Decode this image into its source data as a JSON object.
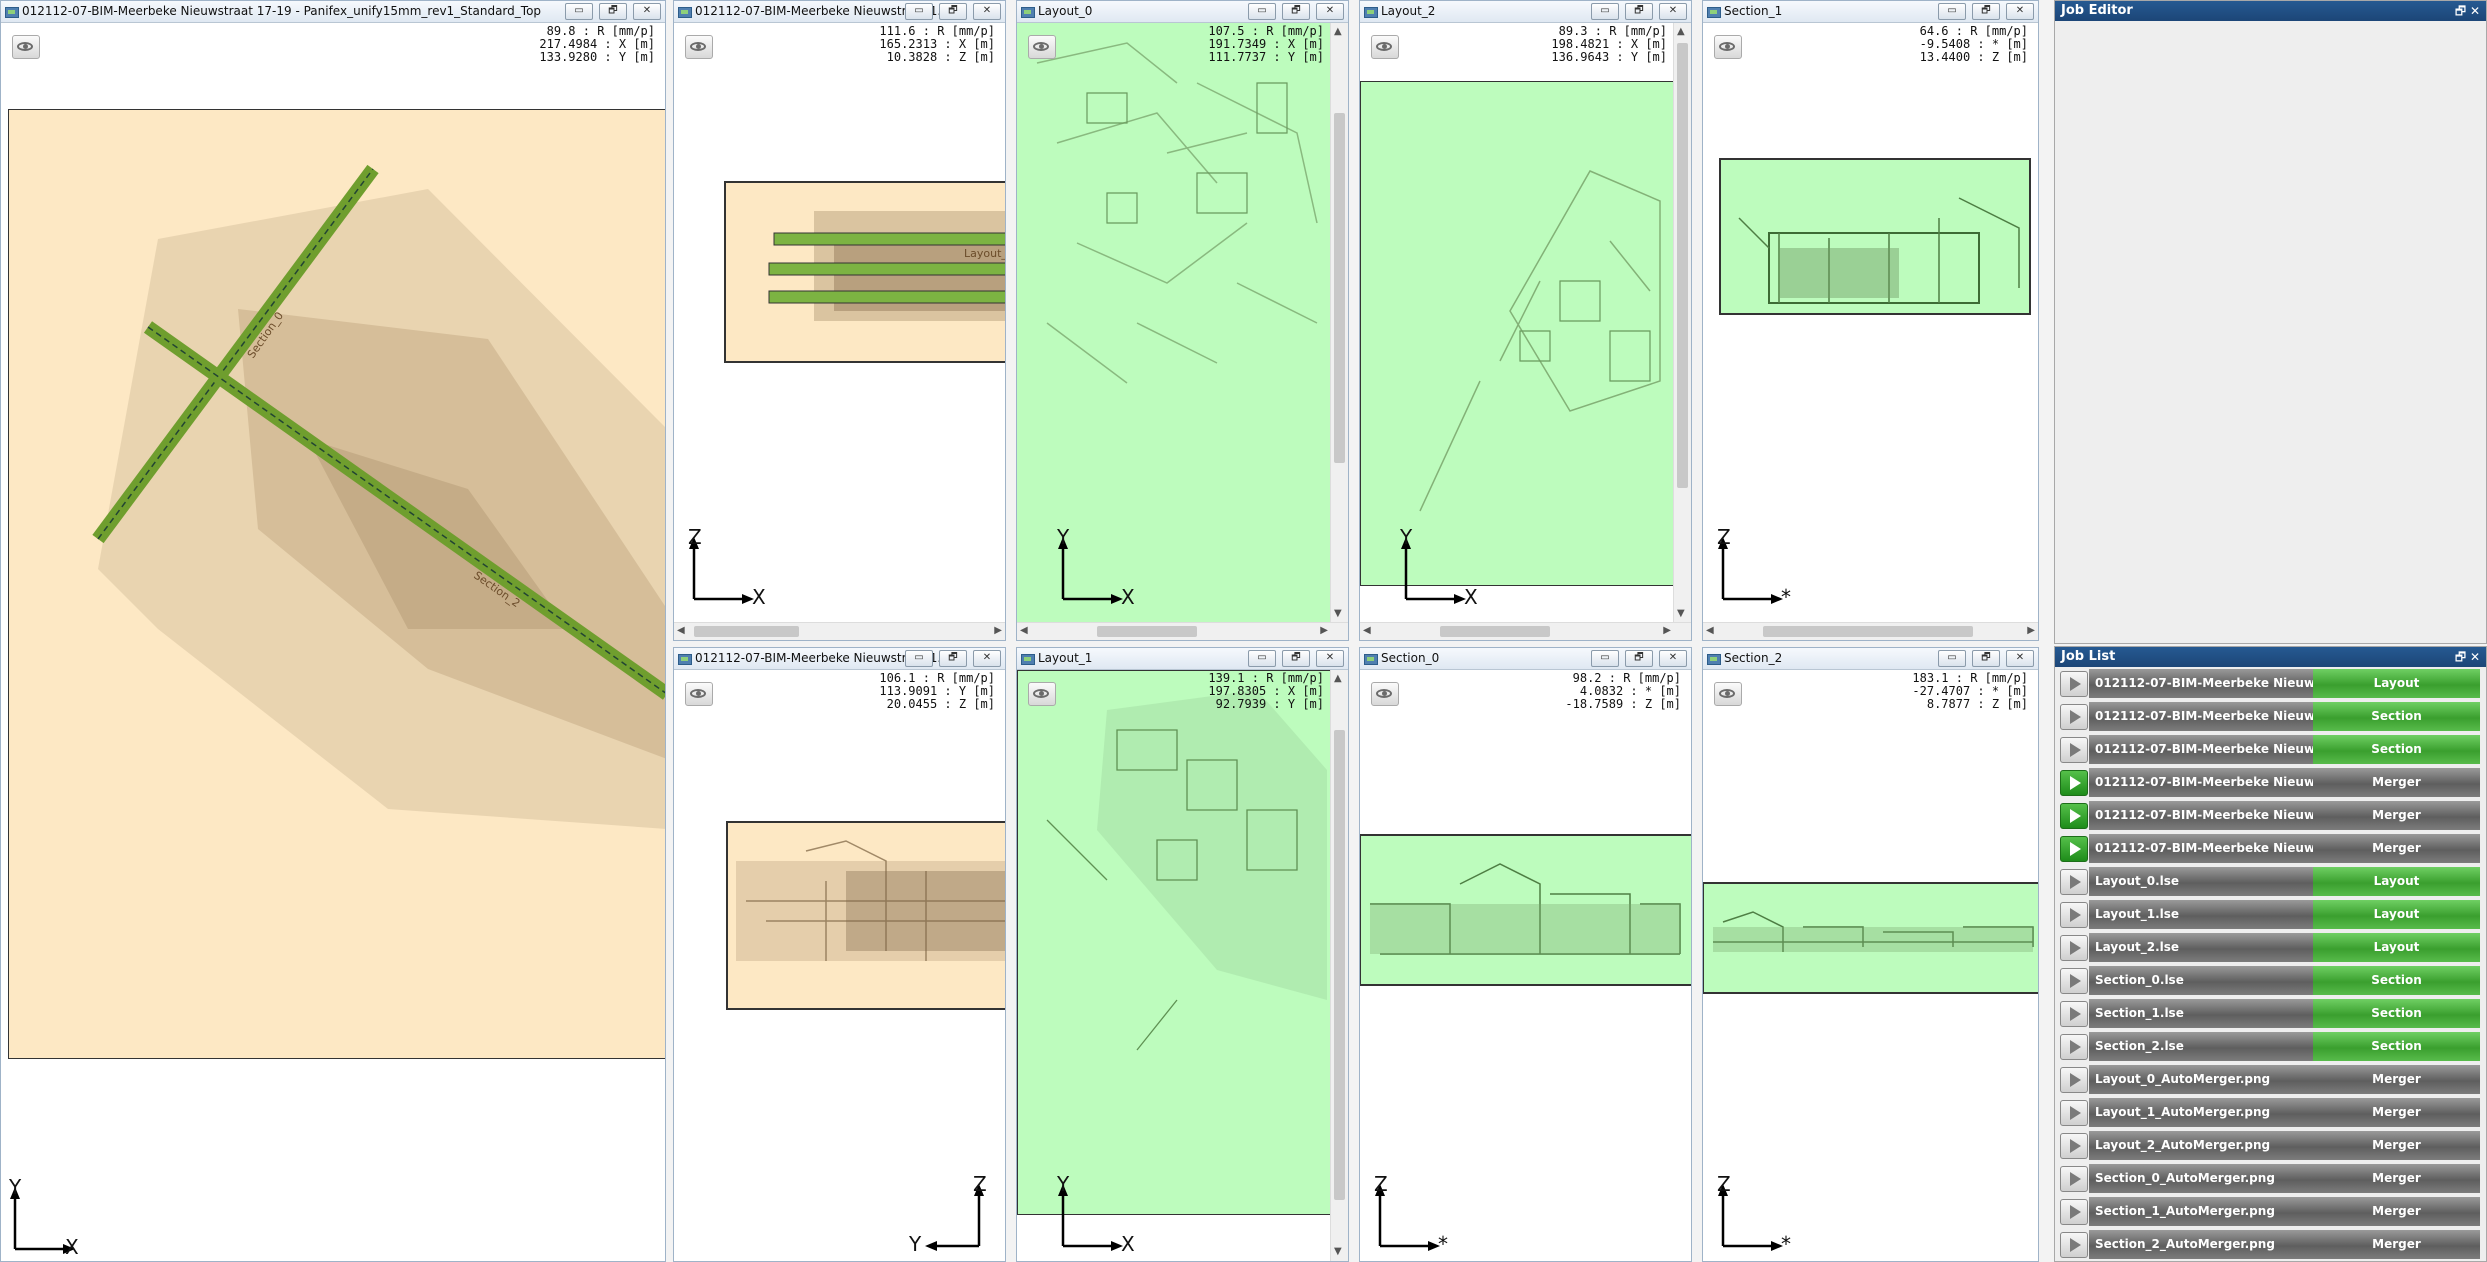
{
  "windows": {
    "top_view": {
      "title": "012112-07-BIM-Meerbeke Nieuwstraat 17-19 - Panifex_unify15mm_rev1_Standard_Top",
      "coords": [
        "89.8 : R [mm/p]",
        "217.4984 : X [m]",
        "133.9280 : Y [m]"
      ],
      "axis": {
        "v": "Y",
        "h": "X"
      },
      "labels": {
        "section0": "Section_0",
        "section2": "Section_2"
      }
    },
    "front_view": {
      "title": "012112-07-BIM-Meerbeke Nieuwstraat 1...",
      "coords": [
        "111.6 : R [mm/p]",
        "165.2313 : X [m]",
        "10.3828 : Z [m]"
      ],
      "axis": {
        "v": "Z",
        "h": "X"
      },
      "labels": {
        "layout": "Layout_"
      }
    },
    "layout0": {
      "title": "Layout_0",
      "coords": [
        "107.5 : R [mm/p]",
        "191.7349 : X [m]",
        "111.7737 : Y [m]"
      ],
      "axis": {
        "v": "Y",
        "h": "X"
      }
    },
    "layout2": {
      "title": "Layout_2",
      "coords": [
        "89.3 : R [mm/p]",
        "198.4821 : X [m]",
        "136.9643 : Y [m]"
      ],
      "axis": {
        "v": "Y",
        "h": "X"
      }
    },
    "section1": {
      "title": "Section_1",
      "coords": [
        "64.6 : R [mm/p]",
        "-9.5408 : * [m]",
        "13.4400 : Z [m]"
      ],
      "axis": {
        "v": "Z",
        "h": "*"
      }
    },
    "side_view": {
      "title": "012112-07-BIM-Meerbeke Nieuwstraat 1...",
      "coords": [
        "106.1 : R [mm/p]",
        "113.9091 : Y [m]",
        "20.0455 : Z [m]"
      ],
      "axis": {
        "v": "Z",
        "h": "Y"
      }
    },
    "layout1": {
      "title": "Layout_1",
      "coords": [
        "139.1 : R [mm/p]",
        "197.8305 : X [m]",
        "92.7939 : Y [m]"
      ],
      "axis": {
        "v": "Y",
        "h": "X"
      }
    },
    "section0": {
      "title": "Section_0",
      "coords": [
        "98.2 : R [mm/p]",
        "4.0832 : * [m]",
        "-18.7589 : Z [m]"
      ],
      "axis": {
        "v": "Z",
        "h": "*"
      }
    },
    "section2": {
      "title": "Section_2",
      "coords": [
        "183.1 : R [mm/p]",
        "-27.4707 : * [m]",
        "8.7877 : Z [m]"
      ],
      "axis": {
        "v": "Z",
        "h": "*"
      }
    }
  },
  "job_editor": {
    "title": "Job Editor",
    "buttons": "🗗 ✕"
  },
  "job_list": {
    "title": "Job List",
    "buttons": "🗗 ✕",
    "items": [
      {
        "name": "012112-07-BIM-Meerbeke Nieuw",
        "type": "Layout",
        "active": false
      },
      {
        "name": "012112-07-BIM-Meerbeke Nieuw",
        "type": "Section",
        "active": false
      },
      {
        "name": "012112-07-BIM-Meerbeke Nieuw",
        "type": "Section",
        "active": false
      },
      {
        "name": "012112-07-BIM-Meerbeke Nieuw",
        "type": "Merger",
        "active": true
      },
      {
        "name": "012112-07-BIM-Meerbeke Nieuw",
        "type": "Merger",
        "active": true
      },
      {
        "name": "012112-07-BIM-Meerbeke Nieuw",
        "type": "Merger",
        "active": true
      },
      {
        "name": "Layout_0.lse",
        "type": "Layout",
        "active": false
      },
      {
        "name": "Layout_1.lse",
        "type": "Layout",
        "active": false
      },
      {
        "name": "Layout_2.lse",
        "type": "Layout",
        "active": false
      },
      {
        "name": "Section_0.lse",
        "type": "Section",
        "active": false
      },
      {
        "name": "Section_1.lse",
        "type": "Section",
        "active": false
      },
      {
        "name": "Section_2.lse",
        "type": "Section",
        "active": false
      },
      {
        "name": "Layout_0_AutoMerger.png",
        "type": "Merger",
        "active": false
      },
      {
        "name": "Layout_1_AutoMerger.png",
        "type": "Merger",
        "active": false
      },
      {
        "name": "Layout_2_AutoMerger.png",
        "type": "Merger",
        "active": false
      },
      {
        "name": "Section_0_AutoMerger.png",
        "type": "Merger",
        "active": false
      },
      {
        "name": "Section_1_AutoMerger.png",
        "type": "Merger",
        "active": false
      },
      {
        "name": "Section_2_AutoMerger.png",
        "type": "Merger",
        "active": false
      }
    ]
  },
  "window_buttons": {
    "minimize": "▭",
    "restore": "🗗",
    "close": "✕"
  },
  "scroll_arrows": {
    "up": "▲",
    "down": "▼",
    "left": "◀",
    "right": "▶"
  },
  "colors": {
    "beige": "#fde8c4",
    "green": "#bdfcbd",
    "strip": "#7cb342",
    "titlebar": "#1c4677"
  }
}
